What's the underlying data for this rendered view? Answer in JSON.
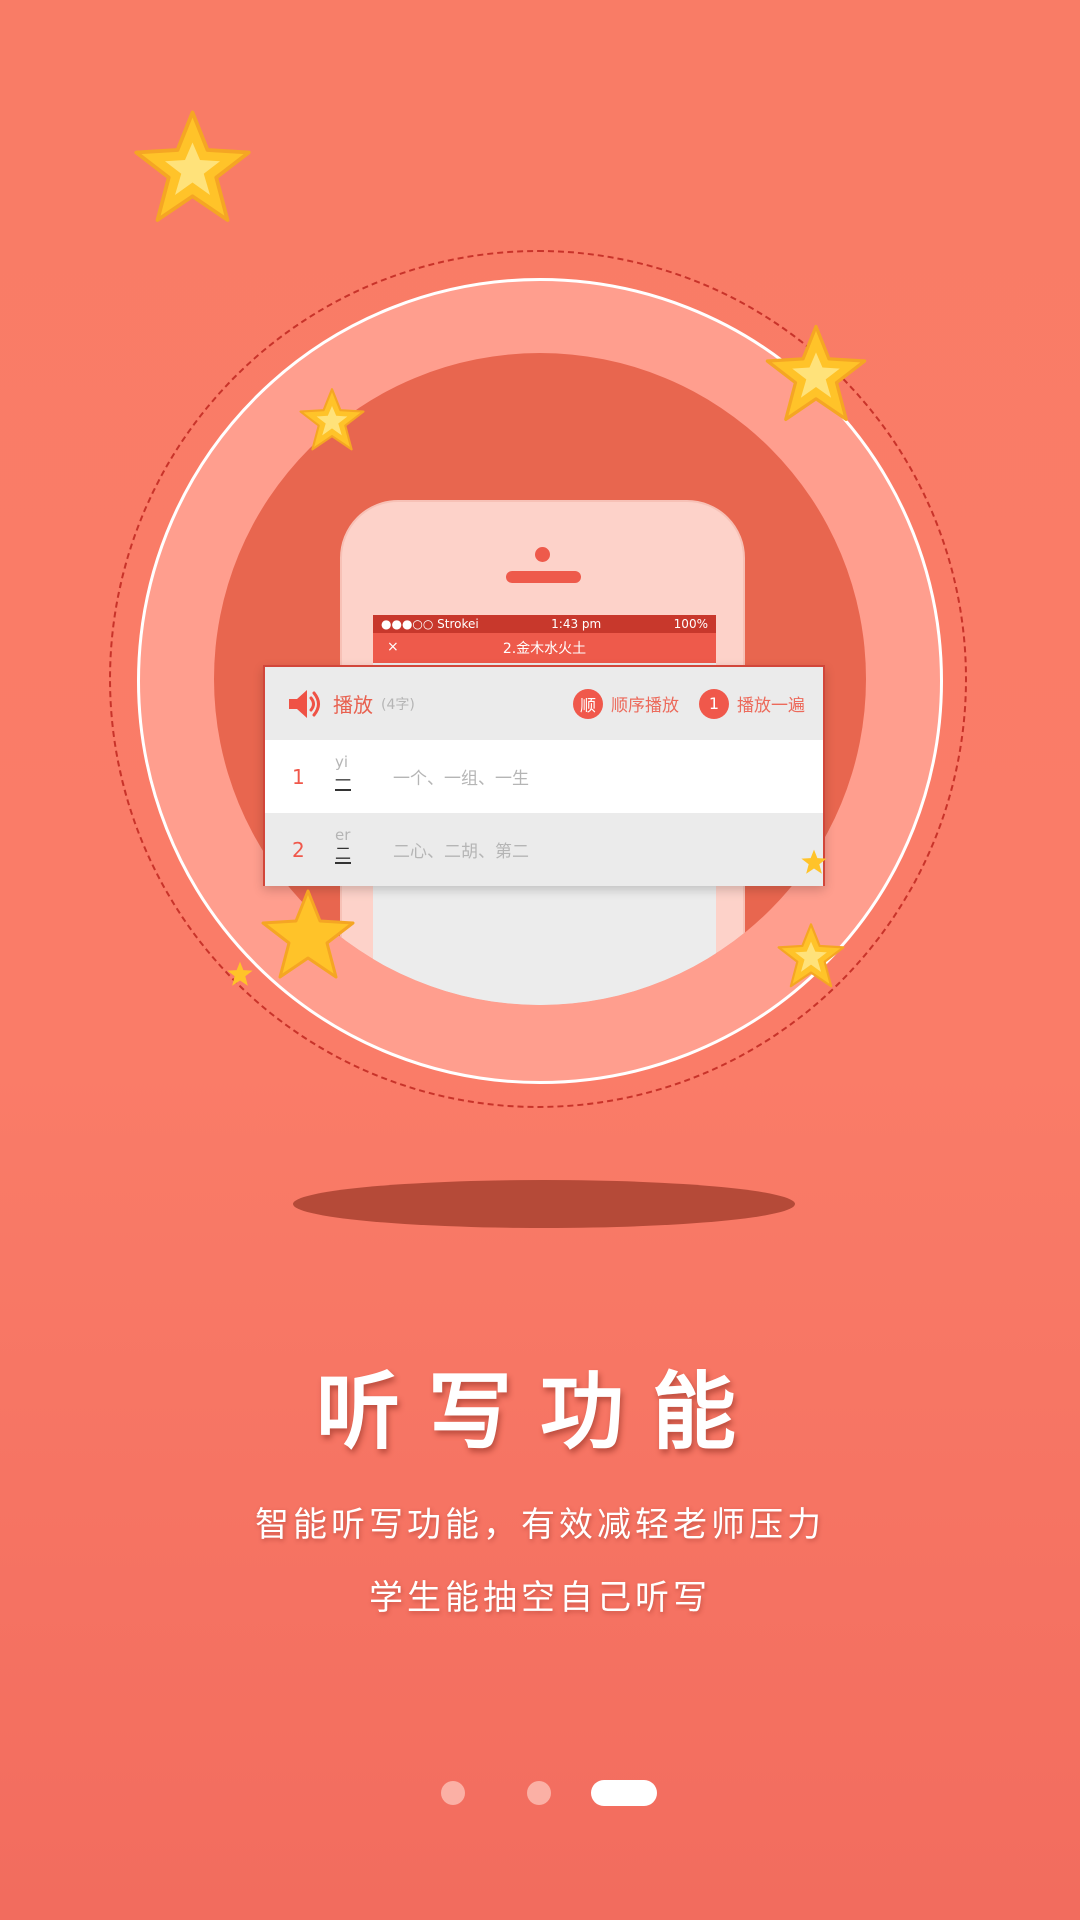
{
  "phone": {
    "carrier": "●●●○○ Strokei",
    "time": "1:43 pm",
    "battery": "100%",
    "close_glyph": "×",
    "nav_title": "2.金木水火土"
  },
  "card": {
    "speaker_icon": "speaker-icon",
    "play_label": "播放",
    "count": "(4字)",
    "order_badge": "顺",
    "order_label": "顺序播放",
    "repeat_badge": "1",
    "repeat_label": "播放一遍",
    "rows": [
      {
        "num": "1",
        "pinyin": "yi",
        "hanzi": "一",
        "words": "一个、一组、一生"
      },
      {
        "num": "2",
        "pinyin": "er",
        "hanzi": "二",
        "words": "二心、二胡、第二"
      }
    ]
  },
  "title": "听写功能",
  "subtitle1": "智能听写功能，有效减轻老师压力",
  "subtitle2": "学生能抽空自己听写",
  "pager": {
    "count": 3,
    "active_index": 2
  },
  "colors": {
    "background": "#f97c66",
    "accent": "#f0584b",
    "ring": "#ff9e8e",
    "star": "#ffc329"
  }
}
